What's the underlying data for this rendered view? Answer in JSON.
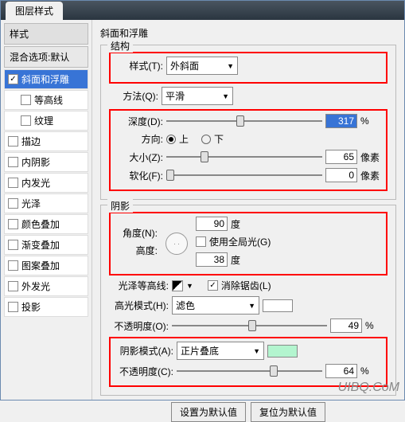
{
  "title": "图层样式",
  "sidebar": {
    "head": "样式",
    "sub": "混合选项:默认",
    "items": [
      {
        "label": "斜面和浮雕",
        "checked": true,
        "active": true,
        "indent": false
      },
      {
        "label": "等高线",
        "checked": false,
        "active": false,
        "indent": true
      },
      {
        "label": "纹理",
        "checked": false,
        "active": false,
        "indent": true
      },
      {
        "label": "描边",
        "checked": false,
        "active": false,
        "indent": false
      },
      {
        "label": "内阴影",
        "checked": false,
        "active": false,
        "indent": false
      },
      {
        "label": "内发光",
        "checked": false,
        "active": false,
        "indent": false
      },
      {
        "label": "光泽",
        "checked": false,
        "active": false,
        "indent": false
      },
      {
        "label": "颜色叠加",
        "checked": false,
        "active": false,
        "indent": false
      },
      {
        "label": "渐变叠加",
        "checked": false,
        "active": false,
        "indent": false
      },
      {
        "label": "图案叠加",
        "checked": false,
        "active": false,
        "indent": false
      },
      {
        "label": "外发光",
        "checked": false,
        "active": false,
        "indent": false
      },
      {
        "label": "投影",
        "checked": false,
        "active": false,
        "indent": false
      }
    ]
  },
  "panel_title": "斜面和浮雕",
  "structure": {
    "legend": "结构",
    "style_label": "样式(T):",
    "style_value": "外斜面",
    "method_label": "方法(Q):",
    "method_value": "平滑",
    "depth_label": "深度(D):",
    "depth_value": "317",
    "depth_unit": "%",
    "direction_label": "方向:",
    "up": "上",
    "down": "下",
    "size_label": "大小(Z):",
    "size_value": "65",
    "size_unit": "像素",
    "soften_label": "软化(F):",
    "soften_value": "0",
    "soften_unit": "像素"
  },
  "shading": {
    "legend": "阴影",
    "angle_label": "角度(N):",
    "angle_value": "90",
    "angle_unit": "度",
    "global_label": "使用全局光(G)",
    "altitude_label": "高度:",
    "altitude_value": "38",
    "altitude_unit": "度",
    "gloss_label": "光泽等高线:",
    "antialias_label": "消除锯齿(L)",
    "highlight_mode_label": "高光模式(H):",
    "highlight_mode_value": "滤色",
    "highlight_color": "#ffffff",
    "highlight_opacity_label": "不透明度(O):",
    "highlight_opacity_value": "49",
    "highlight_opacity_unit": "%",
    "shadow_mode_label": "阴影模式(A):",
    "shadow_mode_value": "正片叠底",
    "shadow_color": "#b3f5cf",
    "shadow_opacity_label": "不透明度(C):",
    "shadow_opacity_value": "64",
    "shadow_opacity_unit": "%"
  },
  "buttons": {
    "default": "设置为默认值",
    "reset": "复位为默认值"
  },
  "watermark": "UIBQ.CoM"
}
